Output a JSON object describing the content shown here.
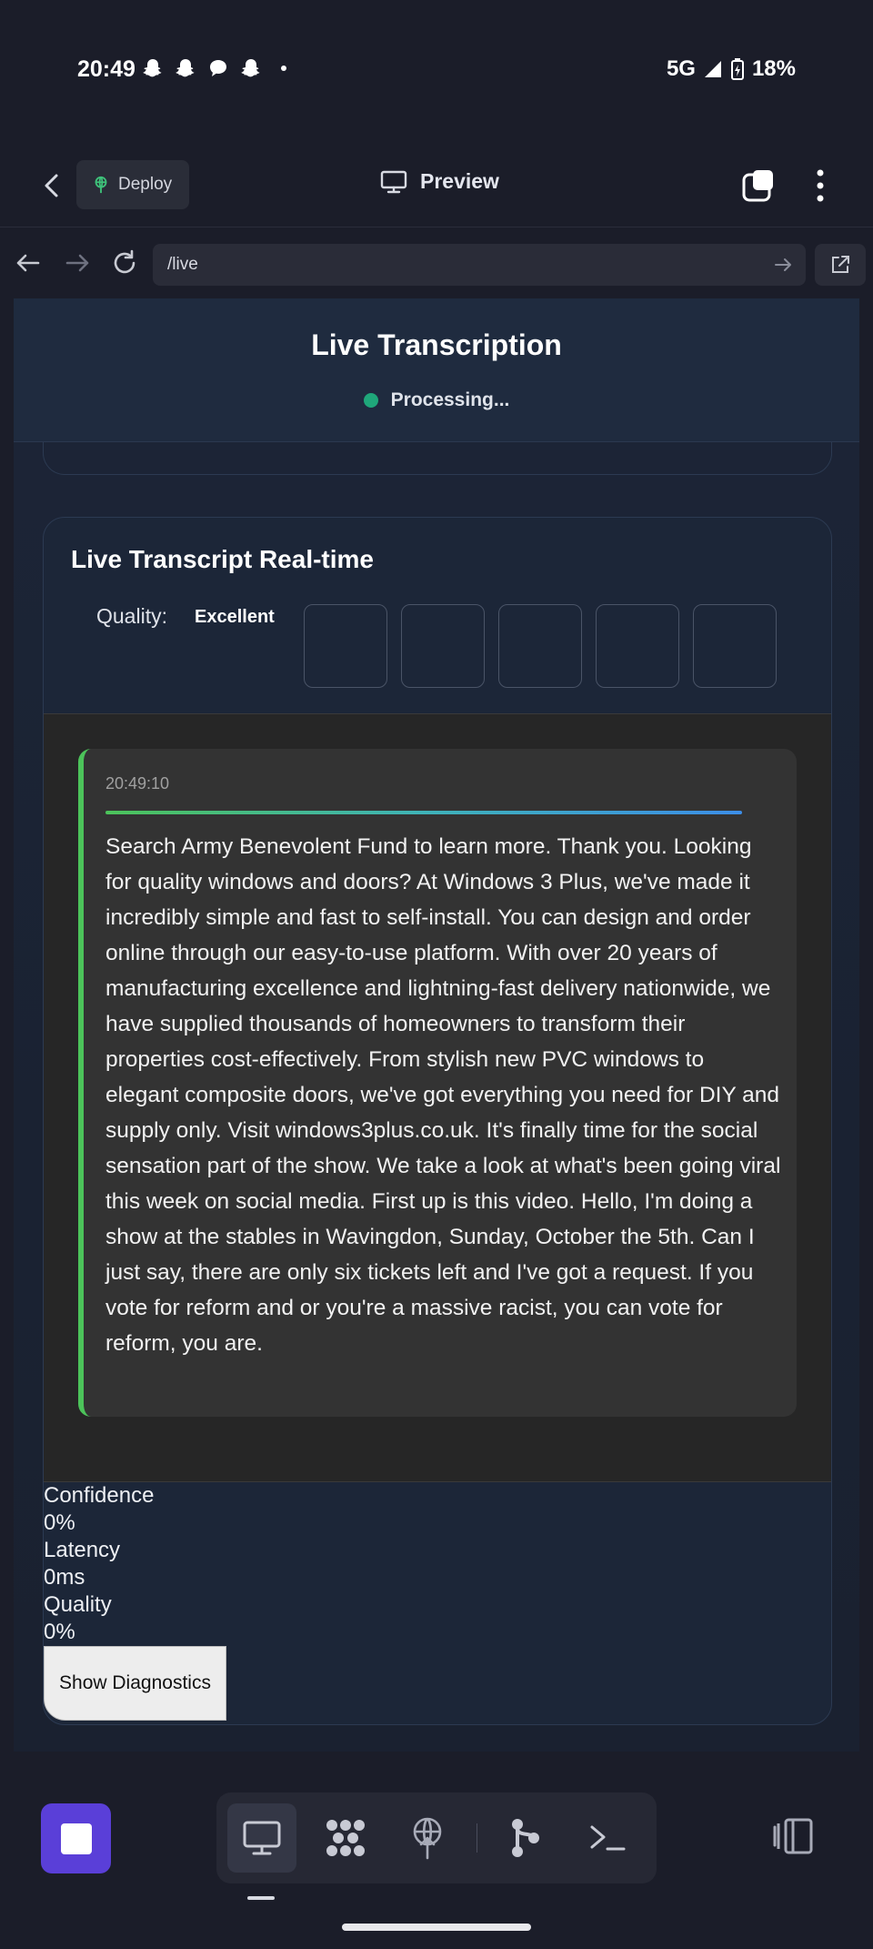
{
  "status_bar": {
    "time": "20:49",
    "network": "5G",
    "battery": "18%",
    "notification_icons": [
      "snapchat-icon",
      "snapchat-icon",
      "chat-bubble-icon",
      "snapchat-icon"
    ]
  },
  "header": {
    "deploy_label": "Deploy",
    "preview_label": "Preview"
  },
  "url_bar": {
    "url": "/live"
  },
  "page": {
    "title": "Live Transcription",
    "status": "Processing...",
    "status_color": "#1fa77a"
  },
  "transcript_card": {
    "title": "Live Transcript Real-time",
    "quality_label": "Quality:",
    "quality_value": "Excellent",
    "quality_boxes": 5,
    "entries": [
      {
        "time": "20:49:10",
        "text": "Search Army Benevolent Fund to learn more. Thank you. Looking for quality windows and doors? At Windows 3 Plus, we've made it incredibly simple and fast to self-install. You can design and order online through our easy-to-use platform. With over 20 years of manufacturing excellence and lightning-fast delivery nationwide, we have supplied thousands of homeowners to transform their properties cost-effectively. From stylish new PVC windows to elegant composite doors, we've got everything you need for DIY and supply only. Visit windows3plus.co.uk. It's finally time for the social sensation part of the show. We take a look at what's been going viral this week on social media. First up is this video. Hello, I'm doing a show at the stables in Wavingdon, Sunday, October the 5th. Can I just say, there are only six tickets left and I've got a request. If you vote for reform and or you're a massive racist, you can vote for reform, you are."
      }
    ],
    "metrics": {
      "confidence_label": "Confidence",
      "confidence_value": "0%",
      "latency_label": "Latency",
      "latency_value": "0ms",
      "quality_label": "Quality",
      "quality_value": "0%"
    },
    "diagnostics_button": "Show Diagnostics"
  },
  "bottom_nav": {
    "accent_color": "#5a3fd8",
    "tools": [
      "desktop-icon",
      "grid-dots-icon",
      "deploy-icon",
      "git-branch-icon",
      "terminal-icon"
    ]
  }
}
